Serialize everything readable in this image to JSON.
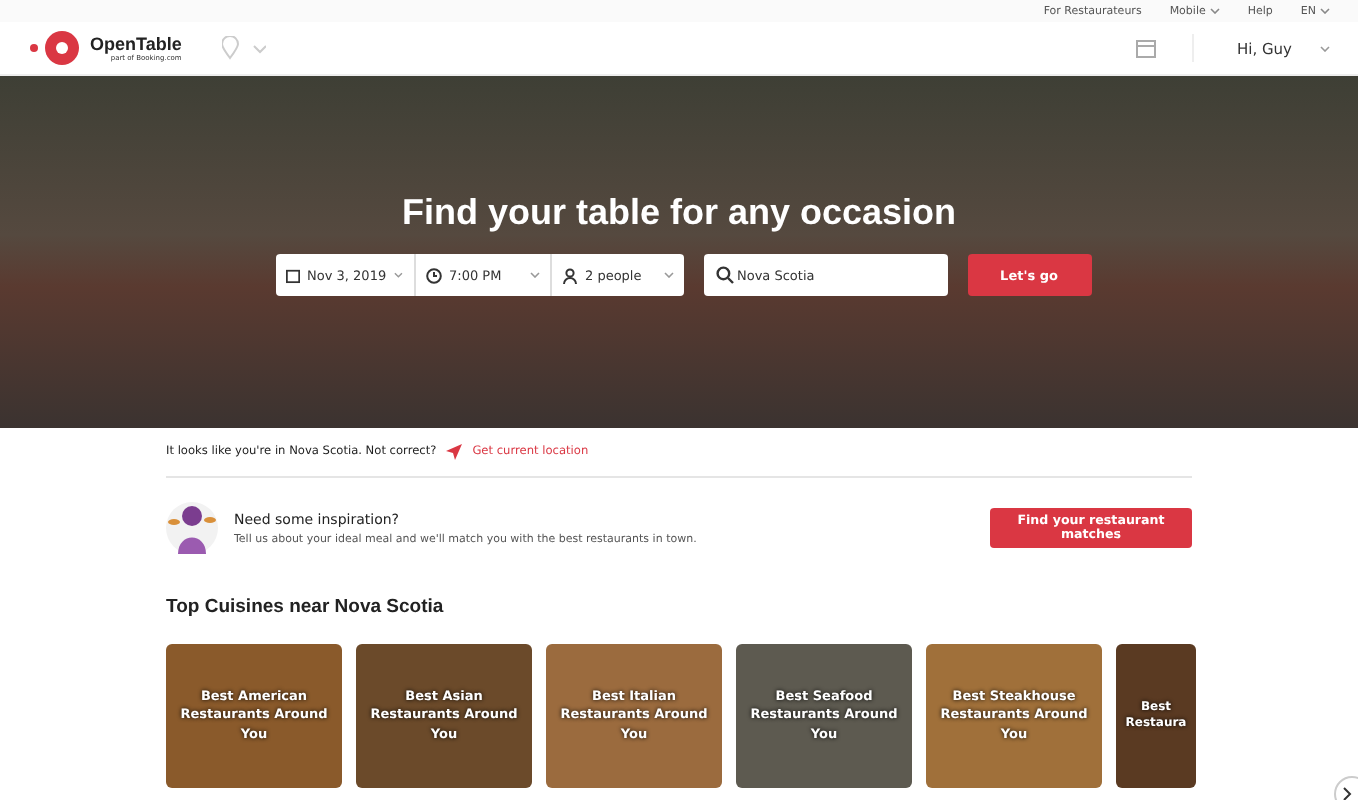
{
  "top_bar": {
    "links": [
      {
        "label": "For Restaurateurs",
        "has_caret": false
      },
      {
        "label": "Mobile",
        "has_caret": true
      },
      {
        "label": "Help",
        "has_caret": false
      },
      {
        "label": "EN",
        "has_caret": true
      }
    ]
  },
  "header": {
    "brand": "OpenTable",
    "brand_sub": "part of Booking.com",
    "user": "Hi, Guy"
  },
  "hero": {
    "title": "Find your table for any occasion",
    "date": "Nov 3, 2019",
    "time": "7:00 PM",
    "party": "2 people",
    "search_value": "Nova Scotia",
    "button": "Let's go"
  },
  "location": {
    "text": "It looks like you're in Nova Scotia. Not correct?",
    "link": "Get current location"
  },
  "inspiration": {
    "title": "Need some inspiration?",
    "text": "Tell us about your ideal meal and we'll match you with the best restaurants in town.",
    "button": "Find your restaurant matches"
  },
  "cuisines": {
    "heading": "Top Cuisines near Nova Scotia",
    "cards": [
      {
        "title": "Best American Restaurants Around You",
        "color": "#8a5a2b"
      },
      {
        "title": "Best Asian Restaurants Around You",
        "color": "#6b4a2a"
      },
      {
        "title": "Best Italian Restaurants Around You",
        "color": "#9b6b3e"
      },
      {
        "title": "Best Seafood Restaurants Around You",
        "color": "#5d5a50"
      },
      {
        "title": "Best Steakhouse Restaurants Around You",
        "color": "#a0703a"
      },
      {
        "title": "Best Restaura",
        "color": "#5a3a22"
      }
    ]
  }
}
